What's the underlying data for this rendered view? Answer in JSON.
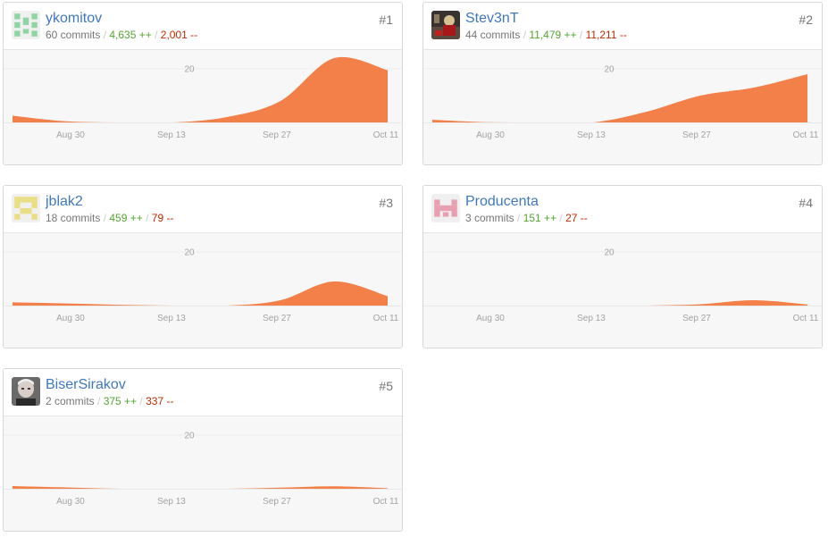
{
  "chart_ticks": {
    "x": [
      "Aug 30",
      "Sep 13",
      "Sep 27",
      "Oct 11"
    ],
    "y": "20"
  },
  "colors": {
    "area": "#f28048",
    "additions": "#55a532",
    "deletions": "#bd2c00",
    "link": "#4078c0"
  },
  "contributors": [
    {
      "rank": "#1",
      "username": "ykomitov",
      "commits": "60 commits",
      "additions": "4,635 ++",
      "deletions": "2,001 --",
      "avatar": "identicon-green"
    },
    {
      "rank": "#2",
      "username": "Stev3nT",
      "commits": "44 commits",
      "additions": "11,479 ++",
      "deletions": "11,211 --",
      "avatar": "photo-avatar"
    },
    {
      "rank": "#3",
      "username": "jblak2",
      "commits": "18 commits",
      "additions": "459 ++",
      "deletions": "79 --",
      "avatar": "identicon-yellow"
    },
    {
      "rank": "#4",
      "username": "Producenta",
      "commits": "3 commits",
      "additions": "151 ++",
      "deletions": "27 --",
      "avatar": "identicon-pink"
    },
    {
      "rank": "#5",
      "username": "BiserSirakov",
      "commits": "2 commits",
      "additions": "375 ++",
      "deletions": "337 --",
      "avatar": "photo-avatar"
    }
  ],
  "chart_data": [
    {
      "type": "area",
      "contributor": "ykomitov",
      "x": [
        "Aug 23",
        "Aug 30",
        "Sep 6",
        "Sep 13",
        "Sep 20",
        "Sep 27",
        "Oct 4",
        "Oct 11"
      ],
      "values": [
        2.5,
        0.4,
        0,
        0,
        2,
        8,
        24,
        19.5
      ],
      "ylim": [
        0,
        24
      ]
    },
    {
      "type": "area",
      "contributor": "Stev3nT",
      "x": [
        "Aug 23",
        "Aug 30",
        "Sep 6",
        "Sep 13",
        "Sep 20",
        "Sep 27",
        "Oct 4",
        "Oct 11"
      ],
      "values": [
        1,
        0.1,
        0,
        0,
        4,
        10,
        13,
        18
      ],
      "ylim": [
        0,
        24
      ]
    },
    {
      "type": "area",
      "contributor": "jblak2",
      "x": [
        "Aug 23",
        "Aug 30",
        "Sep 6",
        "Sep 13",
        "Sep 20",
        "Sep 27",
        "Oct 4",
        "Oct 11"
      ],
      "values": [
        1.2,
        0.8,
        0.3,
        0,
        0,
        2,
        9,
        3.5
      ],
      "ylim": [
        0,
        24
      ]
    },
    {
      "type": "area",
      "contributor": "Producenta",
      "x": [
        "Aug 23",
        "Aug 30",
        "Sep 6",
        "Sep 13",
        "Sep 20",
        "Sep 27",
        "Oct 4",
        "Oct 11"
      ],
      "values": [
        0,
        0,
        0,
        0,
        0,
        0.5,
        2,
        0.4
      ],
      "ylim": [
        0,
        24
      ]
    },
    {
      "type": "area",
      "contributor": "BiserSirakov",
      "x": [
        "Aug 23",
        "Aug 30",
        "Sep 6",
        "Sep 13",
        "Sep 20",
        "Sep 27",
        "Oct 4",
        "Oct 11"
      ],
      "values": [
        1,
        0.5,
        0,
        0,
        0,
        0.4,
        0.9,
        0.2
      ],
      "ylim": [
        0,
        24
      ]
    }
  ]
}
